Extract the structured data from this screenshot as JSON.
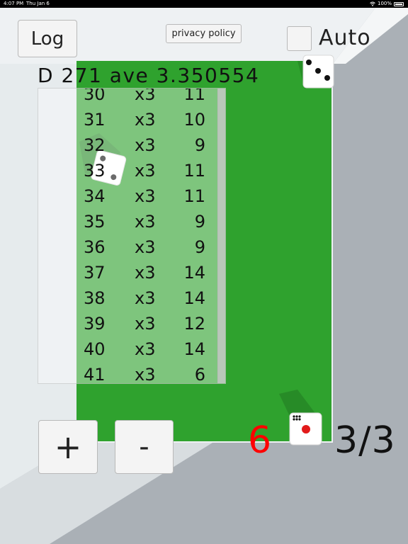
{
  "status_bar": {
    "time": "4:07 PM",
    "date": "Thu Jan 6",
    "battery": "100%",
    "wifi_icon": "wifi-icon",
    "battery_icon": "battery-icon"
  },
  "toolbar": {
    "log_label": "Log",
    "privacy_label": "privacy policy",
    "auto_label": "Auto",
    "auto_checked": false
  },
  "stats": {
    "text": "D 271 ave 3.350554"
  },
  "log": {
    "rows": [
      {
        "idx": "30",
        "mul": "x3",
        "sum": "11"
      },
      {
        "idx": "31",
        "mul": "x3",
        "sum": "10"
      },
      {
        "idx": "32",
        "mul": "x3",
        "sum": "9"
      },
      {
        "idx": "33",
        "mul": "x3",
        "sum": "11"
      },
      {
        "idx": "34",
        "mul": "x3",
        "sum": "11"
      },
      {
        "idx": "35",
        "mul": "x3",
        "sum": "9"
      },
      {
        "idx": "36",
        "mul": "x3",
        "sum": "9"
      },
      {
        "idx": "37",
        "mul": "x3",
        "sum": "14"
      },
      {
        "idx": "38",
        "mul": "x3",
        "sum": "14"
      },
      {
        "idx": "39",
        "mul": "x3",
        "sum": "12"
      },
      {
        "idx": "40",
        "mul": "x3",
        "sum": "14"
      },
      {
        "idx": "41",
        "mul": "x3",
        "sum": "6"
      }
    ]
  },
  "controls": {
    "plus_label": "+",
    "minus_label": "-"
  },
  "result": {
    "last_roll": "6",
    "round": "3/3"
  },
  "colors": {
    "table_green": "#2fa22e",
    "roll_red": "#ff0000",
    "wall_gray": "#aab0b6"
  },
  "dice": [
    {
      "face": 3
    },
    {
      "face": 2
    },
    {
      "face": 1
    }
  ]
}
